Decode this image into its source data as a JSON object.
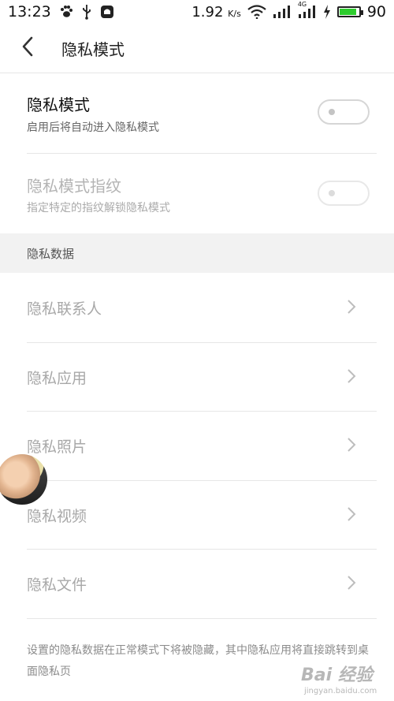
{
  "status_bar": {
    "time": "13:23",
    "left_icons": [
      "paw-icon",
      "usb-icon",
      "notification-icon"
    ],
    "speed": "1.92",
    "speed_unit": "K/s",
    "network": "4G",
    "battery_percent": "90",
    "battery_level": 0.9,
    "battery_color": "#2ecc2e"
  },
  "header": {
    "title": "隐私模式",
    "back_icon": "chevron-left-icon"
  },
  "privacy_mode": {
    "title": "隐私模式",
    "subtitle": "启用后将自动进入隐私模式",
    "enabled": false
  },
  "fingerprint": {
    "title": "隐私模式指纹",
    "subtitle": "指定特定的指纹解锁隐私模式",
    "enabled": false,
    "disabled_state": true
  },
  "section": {
    "title": "隐私数据"
  },
  "data_items": [
    {
      "label": "隐私联系人"
    },
    {
      "label": "隐私应用"
    },
    {
      "label": "隐私照片"
    },
    {
      "label": "隐私视频"
    },
    {
      "label": "隐私文件"
    }
  ],
  "footnote": "设置的隐私数据在正常模式下将被隐藏，其中隐私应用将直接跳转到桌面隐私页",
  "watermark": {
    "brand": "Bai 经验",
    "url": "jingyan.baidu.com"
  }
}
